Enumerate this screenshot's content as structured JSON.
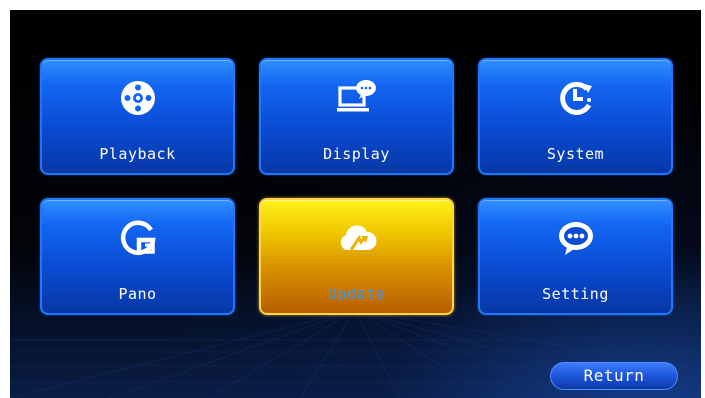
{
  "menu": {
    "items": [
      {
        "label": "Playback",
        "icon": "film-reel-icon"
      },
      {
        "label": "Display",
        "icon": "laptop-chat-icon"
      },
      {
        "label": "System",
        "icon": "clock-refresh-icon"
      },
      {
        "label": "Pano",
        "icon": "panorama-g-icon"
      },
      {
        "label": "Update",
        "icon": "cloud-upload-icon",
        "selected": true
      },
      {
        "label": "Setting",
        "icon": "chat-bubble-icon"
      }
    ]
  },
  "footer": {
    "return_label": "Return"
  },
  "colors": {
    "tile_blue": "#0a4bd3",
    "tile_selected_yellow": "#f0c800",
    "selected_label": "#2f9bff",
    "background": "#000000"
  }
}
